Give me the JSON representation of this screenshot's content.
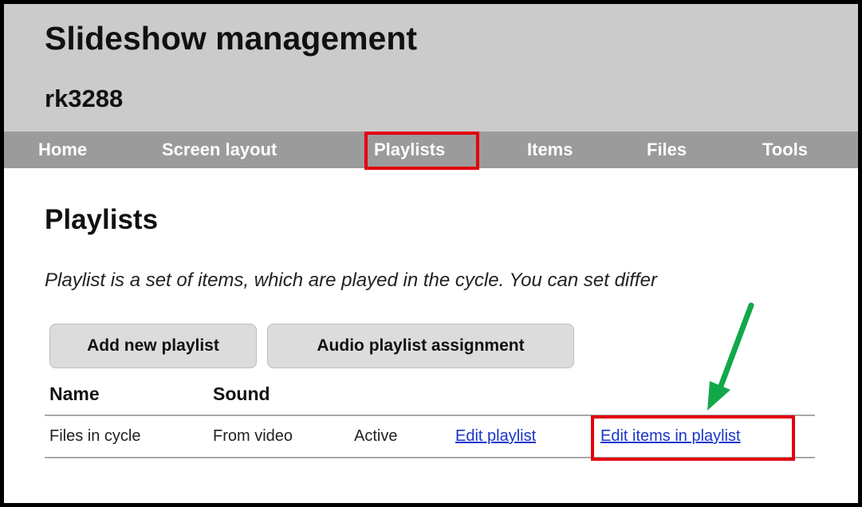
{
  "header": {
    "title": "Slideshow management",
    "site_name": "rk3288"
  },
  "nav": {
    "items": [
      "Home",
      "Screen layout",
      "Playlists",
      "Items",
      "Files",
      "Tools"
    ],
    "selected": "Playlists"
  },
  "main": {
    "heading": "Playlists",
    "description": "Playlist is a set of items, which are played in the cycle. You can set differ",
    "buttons": {
      "add": "Add new playlist",
      "audio": "Audio playlist assignment"
    },
    "table": {
      "columns": [
        "Name",
        "Sound"
      ],
      "rows": [
        {
          "name": "Files in cycle",
          "sound": "From video",
          "status": "Active",
          "edit_link": "Edit playlist",
          "edit_items_link": "Edit items in playlist"
        }
      ]
    }
  },
  "annotations": {
    "highlight_color": "#e3000f",
    "arrow_color": "#12a84a"
  }
}
